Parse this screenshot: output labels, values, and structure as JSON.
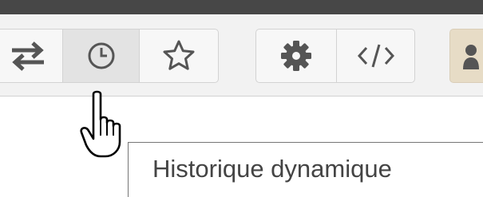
{
  "toolbar": {
    "groups": [
      {
        "name": "navigation",
        "buttons": [
          {
            "icon": "swap-arrows-icon",
            "active": false
          },
          {
            "icon": "clock-icon",
            "active": true,
            "hovered": true
          },
          {
            "icon": "star-outline-icon",
            "active": false
          }
        ]
      },
      {
        "name": "tools",
        "buttons": [
          {
            "icon": "gear-icon",
            "active": false
          },
          {
            "icon": "code-icon",
            "active": false
          }
        ]
      }
    ],
    "peek_icon": "people-icon",
    "peek_color": "#e7dcc6"
  },
  "tooltip": {
    "text": "Historique dynamique"
  },
  "cursor": {
    "icon": "hand-pointer-icon"
  },
  "colors": {
    "top_bar": "#474747",
    "toolbar_bg": "#f2f2f2",
    "icon": "#555555"
  }
}
